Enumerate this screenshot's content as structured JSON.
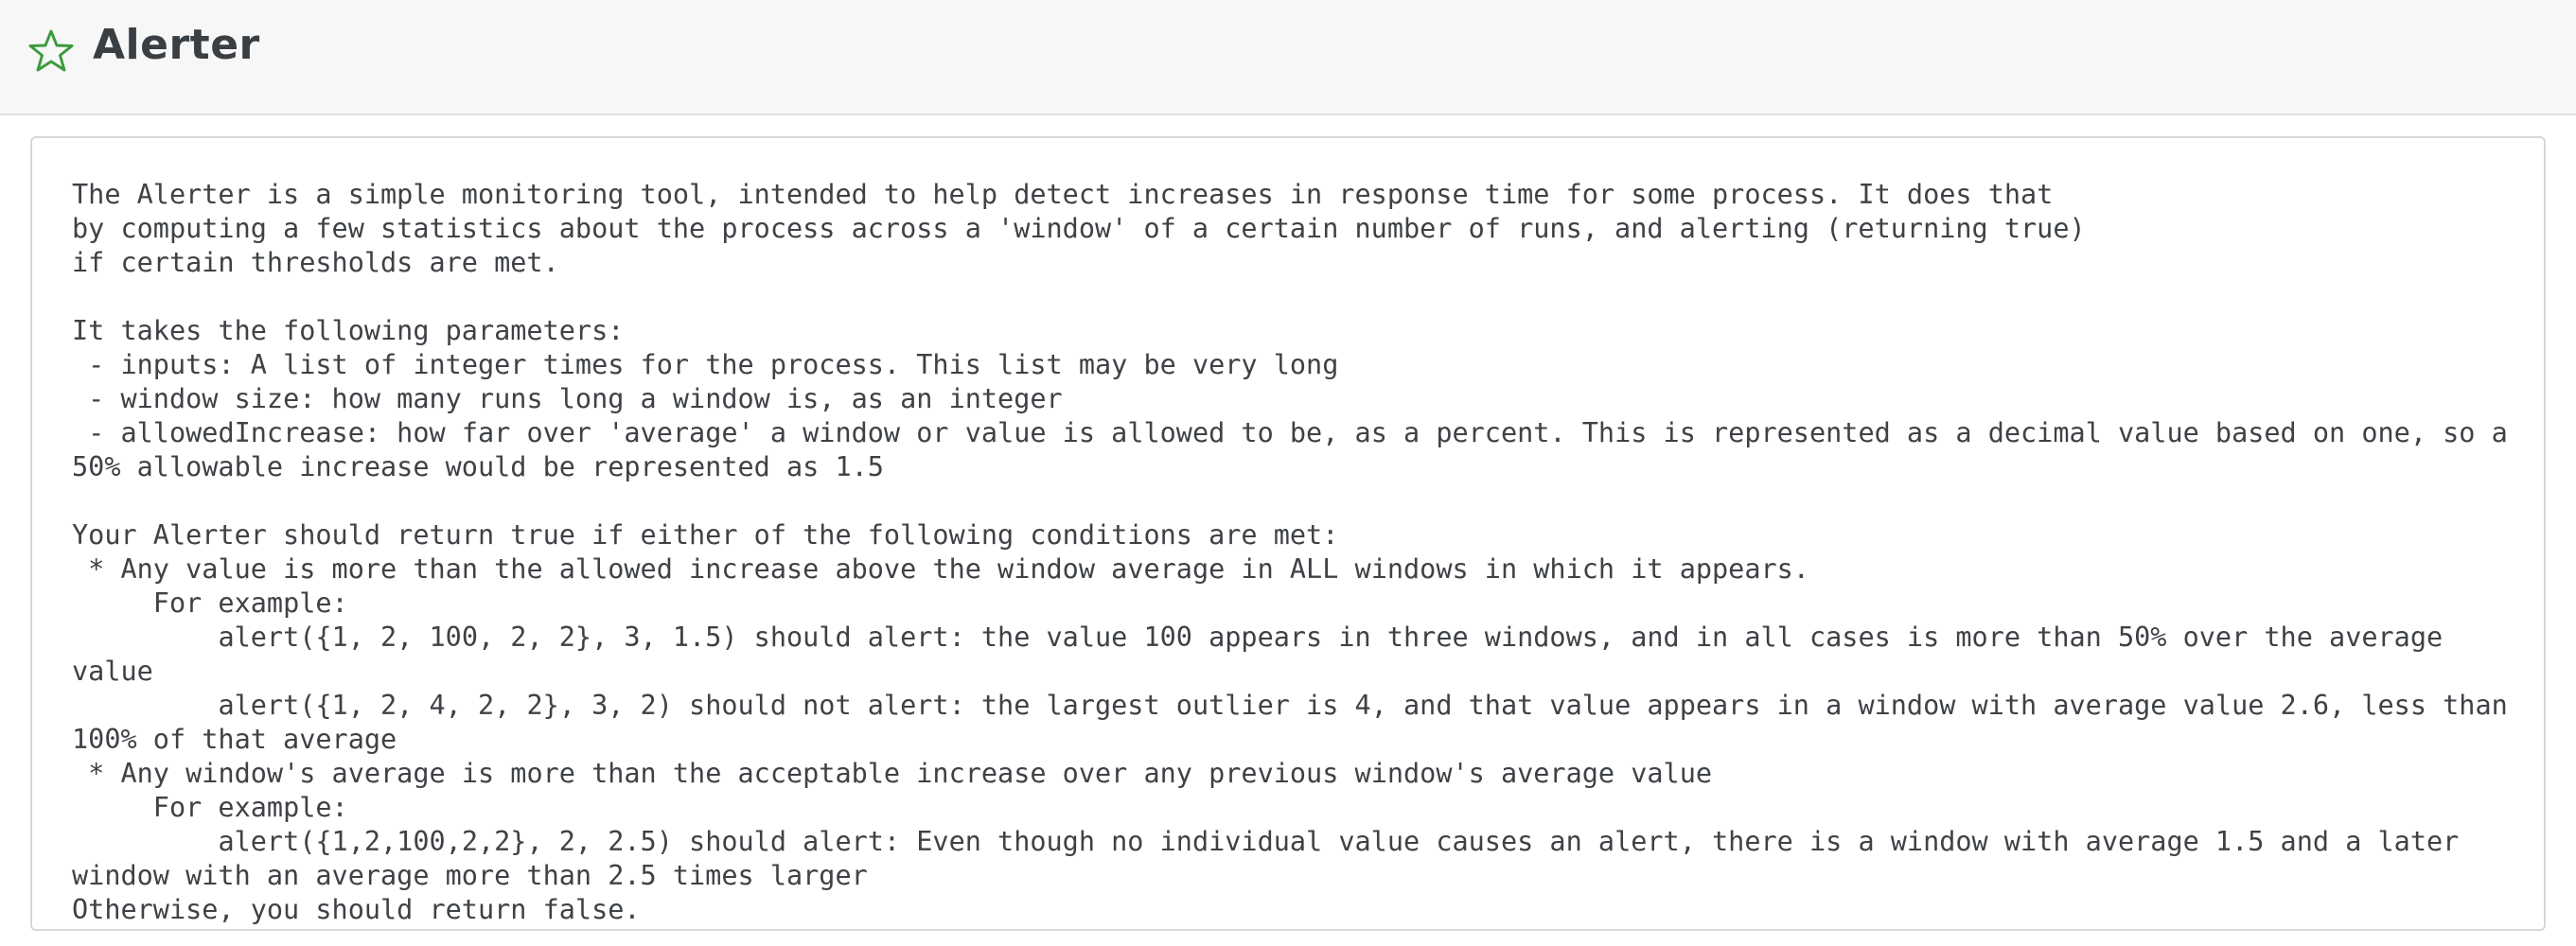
{
  "header": {
    "title": "Alerter",
    "icon": "star-outline-icon",
    "icon_color": "#3c9b3c"
  },
  "description": {
    "text": "The Alerter is a simple monitoring tool, intended to help detect increases in response time for some process. It does that\nby computing a few statistics about the process across a 'window' of a certain number of runs, and alerting (returning true)\nif certain thresholds are met.\n\nIt takes the following parameters:\n - inputs: A list of integer times for the process. This list may be very long\n - window size: how many runs long a window is, as an integer\n - allowedIncrease: how far over 'average' a window or value is allowed to be, as a percent. This is represented as a decimal value based on one, so a\n50% allowable increase would be represented as 1.5\n\nYour Alerter should return true if either of the following conditions are met:\n * Any value is more than the allowed increase above the window average in ALL windows in which it appears.\n     For example:\n         alert({1, 2, 100, 2, 2}, 3, 1.5) should alert: the value 100 appears in three windows, and in all cases is more than 50% over the average value\n         alert({1, 2, 4, 2, 2}, 3, 2) should not alert: the largest outlier is 4, and that value appears in a window with average value 2.6, less than\n100% of that average\n * Any window's average is more than the acceptable increase over any previous window's average value\n     For example:\n         alert({1,2,100,2,2}, 2, 2.5) should alert: Even though no individual value causes an alert, there is a window with average 1.5 and a later\nwindow with an average more than 2.5 times larger\nOtherwise, you should return false."
  }
}
